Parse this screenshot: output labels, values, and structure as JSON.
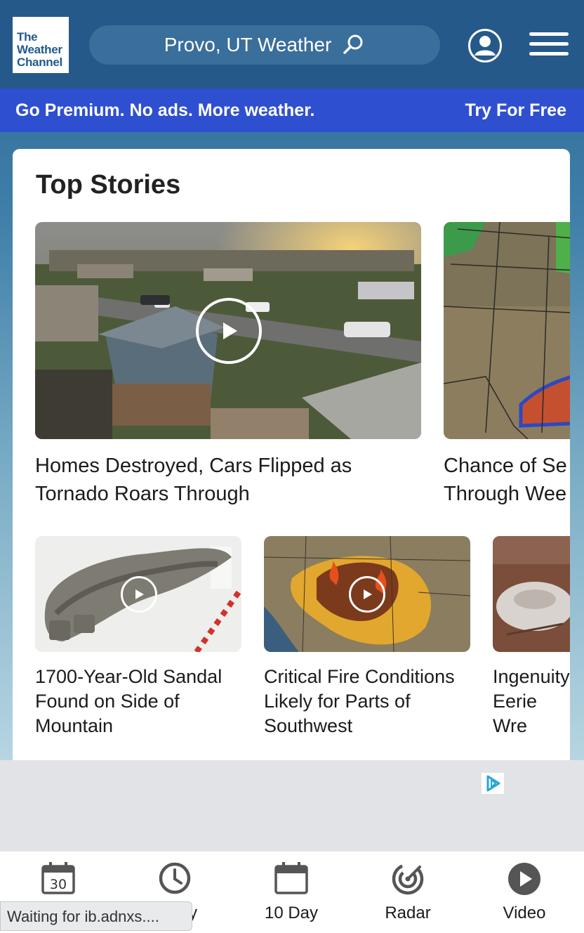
{
  "header": {
    "logo_lines": [
      "The",
      "Weather",
      "Channel"
    ],
    "search_label": "Provo, UT Weather"
  },
  "promo": {
    "message": "Go Premium. No ads. More weather.",
    "cta": "Try For Free"
  },
  "top_stories": {
    "title": "Top Stories",
    "featured": [
      {
        "caption": "Homes Destroyed, Cars Flipped as Tornado Roars Through",
        "has_video": true
      },
      {
        "caption": "Chance of Se Through Wee",
        "has_video": false
      }
    ],
    "small": [
      {
        "caption": "1700-Year-Old Sandal Found on Side of Mountain",
        "has_video": true
      },
      {
        "caption": "Critical Fire Conditions Likely for Parts of Southwest",
        "has_video": true
      },
      {
        "caption": "Ingenuity Eerie Wre Mars",
        "has_video": false
      }
    ]
  },
  "bottom_nav": {
    "items": [
      {
        "label": "",
        "icon": "calendar-day-icon",
        "icon_text": "30"
      },
      {
        "label": "y",
        "icon": "clock-icon"
      },
      {
        "label": "10 Day",
        "icon": "calendar-icon"
      },
      {
        "label": "Radar",
        "icon": "radar-icon"
      },
      {
        "label": "Video",
        "icon": "play-circle-icon"
      }
    ]
  },
  "status_bar": {
    "text": "Waiting for ib.adnxs...."
  },
  "colors": {
    "header_bg": "#25598a",
    "promo_bg": "#2f4fd1",
    "nav_icon": "#555555"
  }
}
